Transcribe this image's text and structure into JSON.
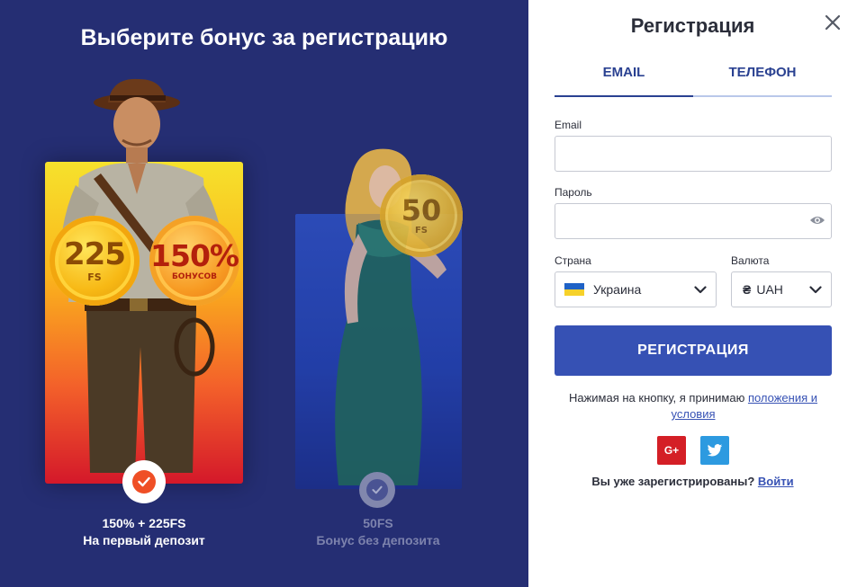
{
  "left": {
    "title": "Выберите бонус за регистрацию",
    "bonus1": {
      "coin_a_value": "225",
      "coin_a_unit": "FS",
      "coin_b_value": "150%",
      "coin_b_unit": "БОНУСОВ",
      "caption_line1": "150% + 225FS",
      "caption_line2": "На первый депозит",
      "selected": true
    },
    "bonus2": {
      "coin_value": "50",
      "coin_unit": "FS",
      "caption_line1": "50FS",
      "caption_line2": "Бонус без депозита",
      "selected": false
    }
  },
  "right": {
    "title": "Регистрация",
    "tabs": [
      {
        "label": "EMAIL",
        "active": true
      },
      {
        "label": "ТЕЛЕФОН",
        "active": false
      }
    ],
    "email_label": "Email",
    "email_value": "",
    "password_label": "Пароль",
    "password_value": "",
    "country_label": "Страна",
    "country_value": "Украина",
    "currency_label": "Валюта",
    "currency_symbol": "₴",
    "currency_value": "UAH",
    "register_button": "РЕГИСТРАЦИЯ",
    "terms_text": "Нажимая на кнопку, я принимаю ",
    "terms_link": "положения и условия",
    "social": {
      "google": "G+",
      "twitter": "twitter-icon"
    },
    "already_text": "Вы уже зарегистрированы? ",
    "login_link": "Войти"
  },
  "colors": {
    "left_bg": "#252e73",
    "accent": "#3651b4",
    "check_active": "#ef4f26",
    "google": "#d41f26",
    "twitter": "#2d9ae0"
  }
}
